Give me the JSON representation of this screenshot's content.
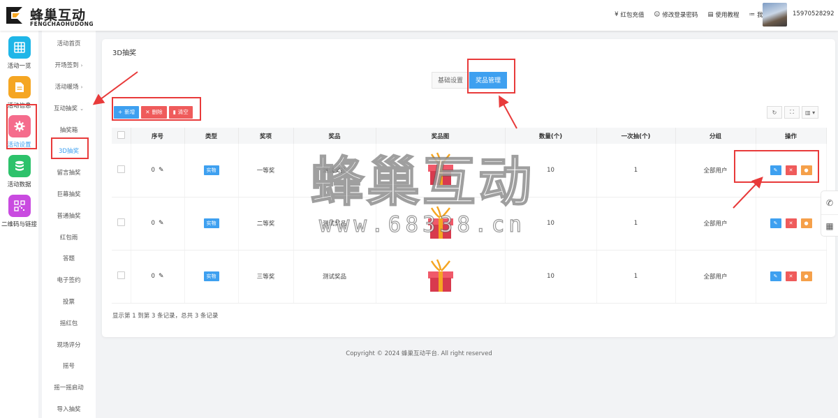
{
  "brand": {
    "name": "蜂巢互动",
    "sub": "FENGCHAOHUDONG"
  },
  "topnav": [
    {
      "icon": "yen-icon",
      "glyph": "¥",
      "label": "红包充值"
    },
    {
      "icon": "user-key-icon",
      "glyph": "☺",
      "label": "修改登录密码"
    },
    {
      "icon": "doc-icon",
      "glyph": "▤",
      "label": "使用教程"
    },
    {
      "icon": "list-icon",
      "glyph": "≔",
      "label": "我的活动"
    }
  ],
  "user": {
    "phone": "15970528292"
  },
  "leftbar": [
    {
      "label": "活动一览",
      "color": "#1fb6e8"
    },
    {
      "label": "活动信息",
      "color": "#f5a623"
    },
    {
      "label": "活动设置",
      "color": "#f56c8c"
    },
    {
      "label": "活动数据",
      "color": "#2dc26b"
    },
    {
      "label": "二维码与链接",
      "color": "#c94be0"
    }
  ],
  "submenu": [
    {
      "label": "活动首页",
      "arrow": ""
    },
    {
      "label": "开场签到",
      "arrow": "›"
    },
    {
      "label": "活动暖场",
      "arrow": "›"
    },
    {
      "label": "互动抽奖",
      "arrow": "⌄"
    },
    {
      "label": "抽奖箱",
      "arrow": ""
    },
    {
      "label": "3D抽奖",
      "arrow": ""
    },
    {
      "label": "留言抽奖",
      "arrow": ""
    },
    {
      "label": "巨幕抽奖",
      "arrow": ""
    },
    {
      "label": "普通抽奖",
      "arrow": ""
    },
    {
      "label": "红包雨",
      "arrow": ""
    },
    {
      "label": "答题",
      "arrow": ""
    },
    {
      "label": "电子签约",
      "arrow": ""
    },
    {
      "label": "投票",
      "arrow": ""
    },
    {
      "label": "摇红包",
      "arrow": ""
    },
    {
      "label": "现场评分",
      "arrow": ""
    },
    {
      "label": "摇号",
      "arrow": ""
    },
    {
      "label": "摇一摇启动",
      "arrow": ""
    },
    {
      "label": "导入抽奖",
      "arrow": ""
    }
  ],
  "page": {
    "title": "3D抽奖",
    "tabs": [
      "基础设置",
      "奖品管理"
    ],
    "toolbar": {
      "add": "新增",
      "delete": "删除",
      "clear": "清空"
    },
    "columns": [
      "序号",
      "类型",
      "奖项",
      "奖品",
      "奖品图",
      "数量(个)",
      "一次抽(个)",
      "分组",
      "操作"
    ],
    "rows": [
      {
        "index": "0",
        "type": "实物",
        "level": "一等奖",
        "prize": "测试奖品",
        "qty": "10",
        "once": "1",
        "group": "全部用户"
      },
      {
        "index": "0",
        "type": "实物",
        "level": "二等奖",
        "prize": "测试奖品",
        "qty": "10",
        "once": "1",
        "group": "全部用户"
      },
      {
        "index": "0",
        "type": "实物",
        "level": "三等奖",
        "prize": "测试奖品",
        "qty": "10",
        "once": "1",
        "group": "全部用户"
      }
    ],
    "footer": "显示第 1 到第 3 条记录，总共 3 条记录"
  },
  "copyright": "Copyright © 2024 蜂巢互动平台. All right reserved",
  "watermark": {
    "cn": "蜂巢互动",
    "url": "www.68338.cn"
  },
  "colors": {
    "accent": "#3ea0f0",
    "danger": "#ef5b5b",
    "warn": "#f5a04a",
    "annotation": "#e83a3a"
  }
}
